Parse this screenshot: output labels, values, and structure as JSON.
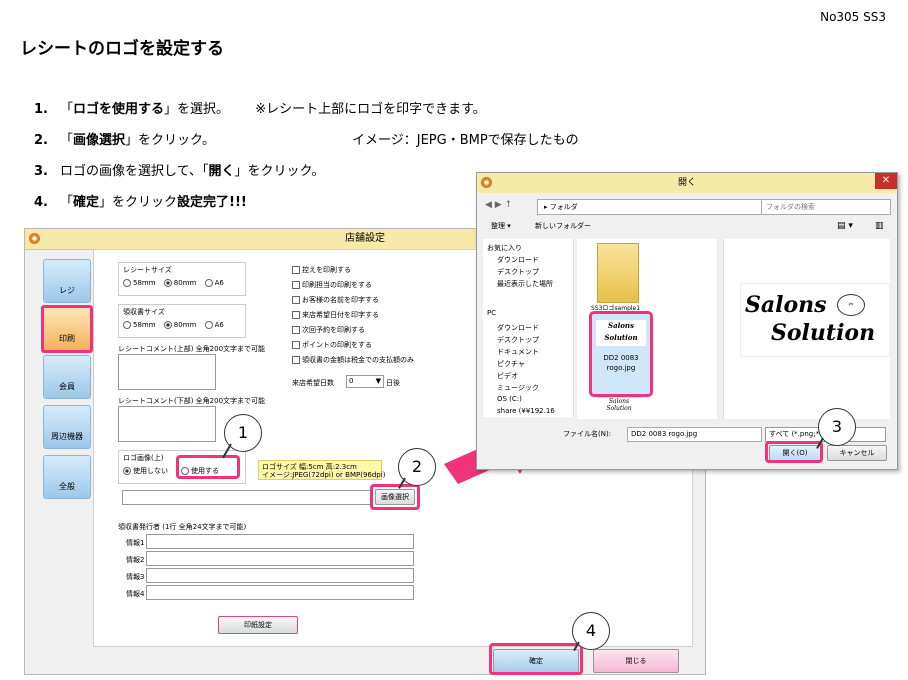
{
  "page_number": "No305 SS3",
  "title": "レシートのロゴを設定する",
  "steps": [
    {
      "num": "1.",
      "pre": "「",
      "bold": "ロゴを使用する",
      "post": "」を選択。",
      "note": "※レシート上部にロゴを印字できます。"
    },
    {
      "num": "2.",
      "pre": "「",
      "bold": "画像選択",
      "post": "」をクリック。",
      "note": "イメージ：JEPG・BMPで保存したもの"
    },
    {
      "num": "3.",
      "pre": "ロゴの画像を選択して、「",
      "bold": "開く",
      "post": "」をクリック。",
      "note": ""
    },
    {
      "num": "4.",
      "pre": "「",
      "bold": "確定",
      "post": "」をクリック",
      "tail": "設定完了!!!",
      "note": ""
    }
  ],
  "store_window": {
    "title": "店舗設定",
    "tabs": [
      "レジ",
      "印刷",
      "会員",
      "周辺機器",
      "全般"
    ],
    "receipt_size": {
      "label": "レシートサイズ",
      "options": [
        "58mm",
        "80mm",
        "A6"
      ],
      "selected": "80mm"
    },
    "slip_size": {
      "label": "領収書サイズ",
      "options": [
        "58mm",
        "80mm",
        "A6"
      ],
      "selected": "80mm"
    },
    "comment_top": "レシートコメント(上部) 全角200文字まで可能",
    "comment_bottom": "レシートコメント(下部) 全角200文字まで可能",
    "checkboxes": [
      "控えを印刷する",
      "印刷担当の印刷をする",
      "お客様の名前を印字する",
      "来店希望日付を印字する",
      "次回予約を印刷する",
      "ポイントの印刷をする",
      "領収書の金額は税金での支払額のみ"
    ],
    "visit_days_label": "来店希望日数",
    "visit_days_value": "0",
    "visit_days_unit": "日後",
    "logo_label": "ロゴ画像(上)",
    "logo_options": [
      "使用しない",
      "使用する"
    ],
    "logo_size_info": "ロゴサイズ 幅:5cm 高:2.3cm",
    "logo_image_info": "イメージ:JPEG(72dpi) or BMP(96dpi)",
    "image_select_button": "画像選択",
    "issuer_label": "領収書発行者 (1行 全角24文字まで可能)",
    "info_rows": [
      "情報1",
      "情報2",
      "情報3",
      "情報4"
    ],
    "print_settings_button": "印紙設定",
    "confirm_button": "確定",
    "close_button": "閉じる"
  },
  "file_dialog": {
    "title": "開く",
    "address": "フォルダ",
    "search_placeholder": "フォルダの検索",
    "organize": "整理 ▾",
    "new_folder": "新しいフォルダー",
    "nav_items": [
      "お気に入り",
      "ダウンロード",
      "デスクトップ",
      "最近表示した場所",
      "PC",
      "ダウンロード",
      "デスクトップ",
      "ドキュメント",
      "ピクチャ",
      "ビデオ",
      "ミュージック",
      "OS (C:)",
      "share (¥¥192.16"
    ],
    "folder_name": "SS3ロゴsample1",
    "selected_file": "DD2 0083 rogo.jpg",
    "file_caption_top": "DD2 0083",
    "file_caption_bottom": "rogo.jpg",
    "file_name_label": "ファイル名(N):",
    "file_type": "すべて (*.png;*.",
    "open_button": "開く(O)",
    "cancel_button": "キャンセル",
    "logo_line1": "Salons",
    "logo_line2": "Solution"
  },
  "callouts": [
    "1",
    "2",
    "3",
    "4"
  ]
}
